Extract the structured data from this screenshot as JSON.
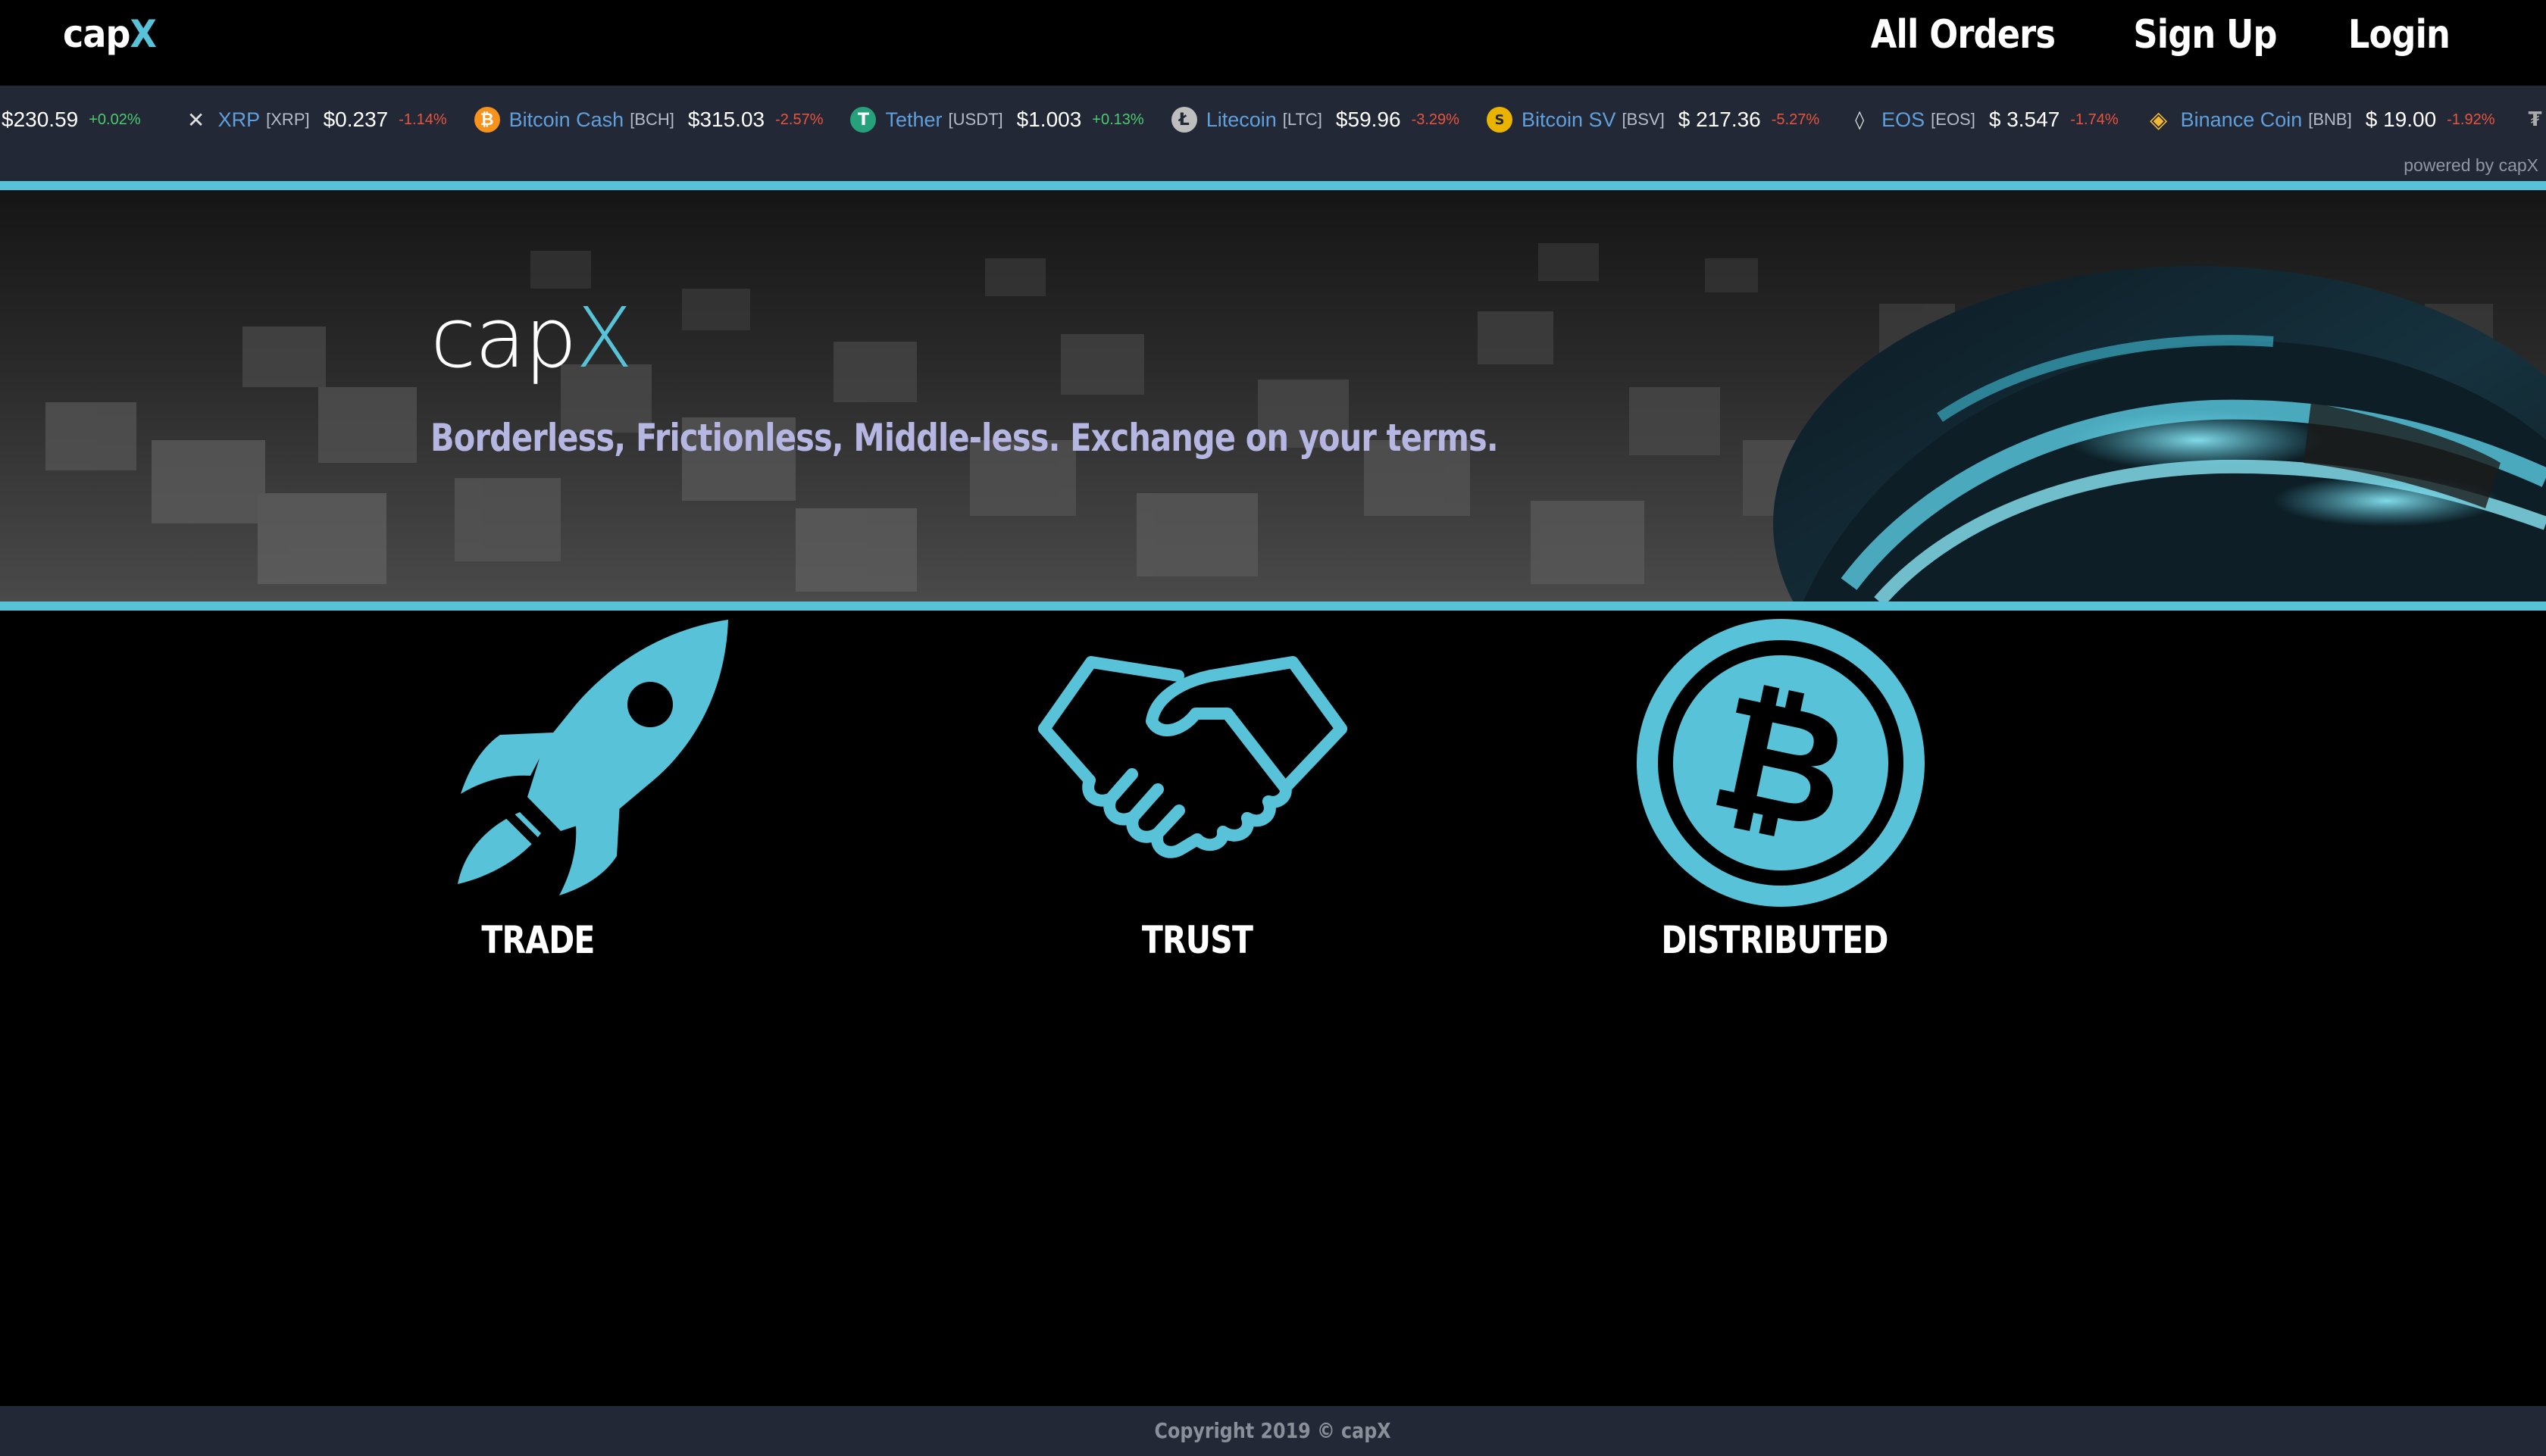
{
  "nav": {
    "logo_prefix": "cap",
    "logo_accent": "X",
    "links": [
      "All Orders",
      "Sign Up",
      "Login"
    ]
  },
  "ticker": {
    "items": [
      {
        "name": "",
        "symbol": "",
        "price": "$230.59",
        "change": "+0.02%",
        "direction": "up",
        "icon": "none",
        "icon_color": "#222835"
      },
      {
        "name": "XRP",
        "symbol": "[XRP]",
        "price": "$0.237",
        "change": "-1.14%",
        "direction": "down",
        "icon": "xrp-icon",
        "icon_color": "#222835"
      },
      {
        "name": "Bitcoin Cash",
        "symbol": "[BCH]",
        "price": "$315.03",
        "change": "-2.57%",
        "direction": "down",
        "icon": "bitcoin-cash-icon",
        "icon_color": "#f7931a"
      },
      {
        "name": "Tether",
        "symbol": "[USDT]",
        "price": "$1.003",
        "change": "+0.13%",
        "direction": "up",
        "icon": "tether-icon",
        "icon_color": "#26a17b"
      },
      {
        "name": "Litecoin",
        "symbol": "[LTC]",
        "price": "$59.96",
        "change": "-3.29%",
        "direction": "down",
        "icon": "litecoin-icon",
        "icon_color": "#bebebe"
      },
      {
        "name": "Bitcoin SV",
        "symbol": "[BSV]",
        "price": "$ 217.36",
        "change": "-5.27%",
        "direction": "down",
        "icon": "bitcoin-sv-icon",
        "icon_color": "#eab300"
      },
      {
        "name": "EOS",
        "symbol": "[EOS]",
        "price": "$ 3.547",
        "change": "-1.74%",
        "direction": "down",
        "icon": "eos-icon",
        "icon_color": "#222835"
      },
      {
        "name": "Binance Coin",
        "symbol": "[BNB]",
        "price": "$ 19.00",
        "change": "-1.92%",
        "direction": "down",
        "icon": "binance-coin-icon",
        "icon_color": "#f3ba2f"
      }
    ],
    "powered_by": "powered by capX"
  },
  "hero": {
    "title_prefix": "cap",
    "title_accent": "X",
    "tagline": "Borderless, Frictionless, Middle-less. Exchange on your terms."
  },
  "features": [
    {
      "label": "TRADE",
      "icon": "rocket-icon"
    },
    {
      "label": "TRUST",
      "icon": "handshake-icon"
    },
    {
      "label": "DISTRIBUTED",
      "icon": "bitcoin-coin-icon"
    }
  ],
  "footer": {
    "copyright": "Copyright 2019 © capX"
  },
  "colors": {
    "accent": "#57c2d8",
    "ticker_bg": "#222835",
    "positive": "#4dca6e",
    "negative": "#e8543e",
    "tagline": "#b6b6e2"
  }
}
